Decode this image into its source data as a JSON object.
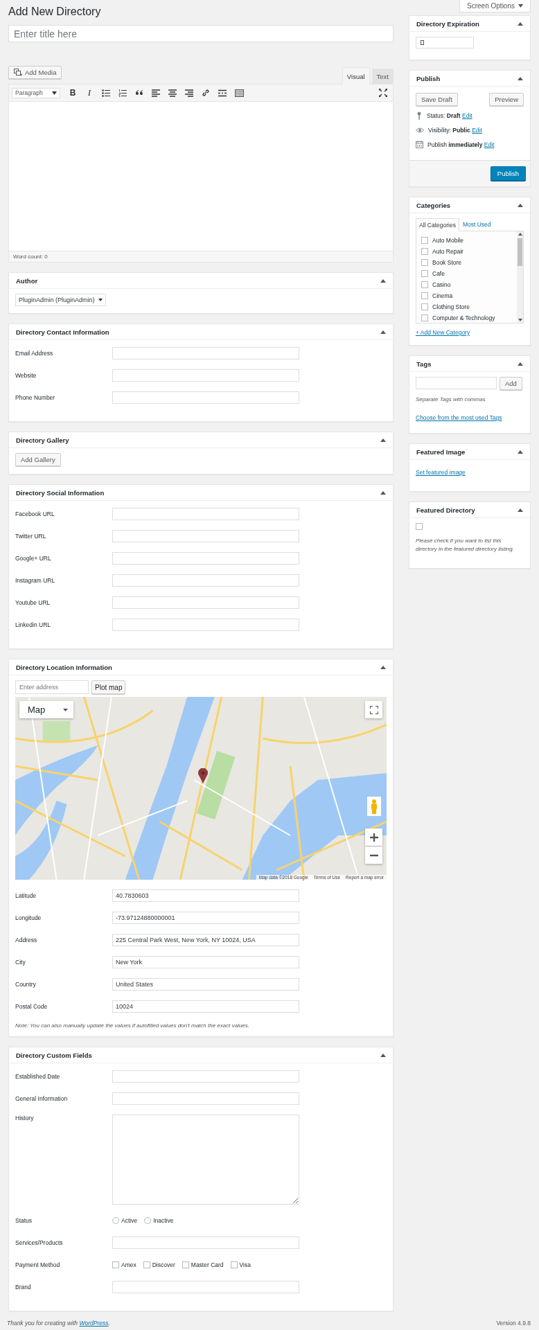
{
  "screen_options": "Screen Options",
  "page_title": "Add New Directory",
  "title_field": {
    "placeholder": "Enter title here"
  },
  "editor": {
    "add_media": "Add Media",
    "tabs": [
      {
        "label": "Visual",
        "selected": true
      },
      {
        "label": "Text",
        "selected": false
      }
    ],
    "format": "Paragraph",
    "toolbar": [
      {
        "kind": "bold",
        "label": "B"
      },
      {
        "kind": "italic",
        "label": "I"
      },
      {
        "kind": "bullets"
      },
      {
        "kind": "numbers"
      },
      {
        "kind": "quote"
      },
      {
        "kind": "align-left"
      },
      {
        "kind": "align-center"
      },
      {
        "kind": "align-right"
      },
      {
        "kind": "link"
      },
      {
        "kind": "more"
      },
      {
        "kind": "toolbar-toggle"
      }
    ],
    "word_count": "Word count: 0"
  },
  "main_boxes": [
    {
      "kind": "select",
      "title": "Author",
      "value": "PluginAdmin (PluginAdmin)"
    },
    {
      "kind": "fields",
      "title": "Directory Contact Information",
      "fields": [
        {
          "label": "Email Address"
        },
        {
          "label": "Website"
        },
        {
          "label": "Phone Number"
        }
      ]
    },
    {
      "kind": "button",
      "title": "Directory Gallery",
      "button": "Add Gallery"
    },
    {
      "kind": "fields",
      "title": "Directory Social Information",
      "fields": [
        {
          "label": "Facebook URL"
        },
        {
          "label": "Twitter URL"
        },
        {
          "label": "Google+ URL"
        },
        {
          "label": "Instagram URL"
        },
        {
          "label": "Youtube URL"
        },
        {
          "label": "Linkedin URL"
        }
      ]
    },
    {
      "kind": "location",
      "title": "Directory Location Information",
      "address_placeholder": "Enter address",
      "plot_button": "Plot map",
      "map_type": "Map",
      "attribution": [
        "Map data ©2018 Google",
        "Terms of Use",
        "Report a map error"
      ],
      "fields": [
        {
          "label": "Latitude",
          "value": "40.7830603"
        },
        {
          "label": "Longitude",
          "value": "-73.97124880000001"
        },
        {
          "label": "Address",
          "value": "225 Central Park West, New York, NY 10024, USA"
        },
        {
          "label": "City",
          "value": "New York"
        },
        {
          "label": "Country",
          "value": "United States"
        },
        {
          "label": "Postal Code",
          "value": "10024"
        }
      ],
      "note": "Note: You can also manually update the values if autofilled values don't match the exact values."
    },
    {
      "kind": "custom",
      "title": "Directory Custom Fields",
      "fields": [
        {
          "kind": "text",
          "label": "Established Date"
        },
        {
          "kind": "text",
          "label": "General Information"
        },
        {
          "kind": "textarea",
          "label": "History"
        },
        {
          "kind": "radio",
          "label": "Status",
          "options": [
            {
              "label": "Active",
              "selected": false
            },
            {
              "label": "Inactive",
              "selected": false
            }
          ]
        },
        {
          "kind": "text",
          "label": "Services/Products"
        },
        {
          "kind": "checkbox",
          "label": "Payment Method",
          "options": [
            {
              "label": "Amex",
              "checked": false
            },
            {
              "label": "Discover",
              "checked": false
            },
            {
              "label": "Master Card",
              "checked": false
            },
            {
              "label": "Visa",
              "checked": false
            }
          ]
        },
        {
          "kind": "text",
          "label": "Brand"
        }
      ]
    }
  ],
  "sidebar": {
    "expiration": {
      "title": "Directory Expiration"
    },
    "publish": {
      "title": "Publish",
      "save_draft": "Save Draft",
      "preview": "Preview",
      "rows": [
        {
          "kind": "status",
          "text": "Status: **Draft**",
          "link": "Edit"
        },
        {
          "kind": "visibility",
          "text": "Visibility: **Public**",
          "link": "Edit"
        },
        {
          "kind": "schedule",
          "text": "Publish **immediately**",
          "link": "Edit"
        }
      ],
      "publish_button": "Publish"
    },
    "categories": {
      "title": "Categories",
      "tabs": [
        {
          "label": "All Categories",
          "selected": true
        },
        {
          "label": "Most Used",
          "selected": false
        }
      ],
      "items": [
        {
          "label": "Auto Mobile",
          "checked": false
        },
        {
          "label": "Auto Repair",
          "checked": false
        },
        {
          "label": "Book Store",
          "checked": false
        },
        {
          "label": "Cafe",
          "checked": false
        },
        {
          "label": "Casino",
          "checked": false
        },
        {
          "label": "Cinema",
          "checked": false
        },
        {
          "label": "Clothing Store",
          "checked": false
        },
        {
          "label": "Computer & Technology",
          "checked": false
        }
      ],
      "add_link": "+ Add New Category"
    },
    "tags": {
      "title": "Tags",
      "button": "Add",
      "hint": "Separate Tags with commas",
      "link": "Choose from the most used Tags"
    },
    "featured_image": {
      "title": "Featured Image",
      "link": "Set featured image"
    },
    "featured_directory": {
      "title": "Featured Directory",
      "checked": false,
      "note": "Please check if you want to list this directory in the featured directory listing."
    }
  },
  "footer": {
    "thanks": "Thank you for creating with ",
    "link": "WordPress",
    "end": ".",
    "version": "Version 4.9.8"
  }
}
